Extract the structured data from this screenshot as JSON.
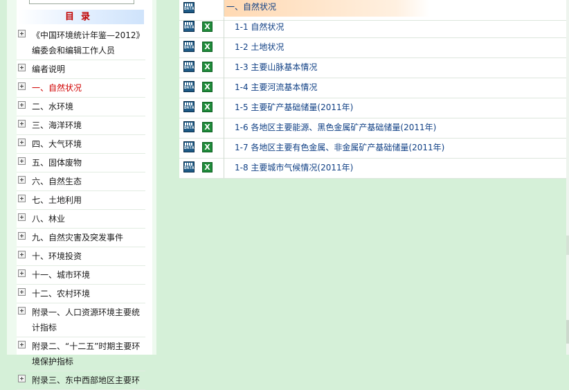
{
  "sidebar": {
    "header": "目录",
    "items": [
      {
        "label": "《中国环境统计年鉴—2012》编委会和编辑工作人员",
        "active": false
      },
      {
        "label": "编者说明",
        "active": false
      },
      {
        "label": "一、自然状况",
        "active": true
      },
      {
        "label": "二、水环境",
        "active": false
      },
      {
        "label": "三、海洋环境",
        "active": false
      },
      {
        "label": "四、大气环境",
        "active": false
      },
      {
        "label": "五、固体废物",
        "active": false
      },
      {
        "label": "六、自然生态",
        "active": false
      },
      {
        "label": "七、土地利用",
        "active": false
      },
      {
        "label": "八、林业",
        "active": false
      },
      {
        "label": "九、自然灾害及突发事件",
        "active": false
      },
      {
        "label": "十、环境投资",
        "active": false
      },
      {
        "label": "十一、城市环境",
        "active": false
      },
      {
        "label": "十二、农村环境",
        "active": false
      },
      {
        "label": "附录一、人口资源环境主要统计指标",
        "active": false
      },
      {
        "label": "附录二、“十二五”时期主要环境保护指标",
        "active": false
      },
      {
        "label": "附录三、东中西部地区主要环",
        "active": false
      }
    ]
  },
  "table": {
    "section_title": "一、自然状况",
    "icon_text": "DATA",
    "excel_glyph": "X",
    "rows": [
      {
        "label": "1-1 自然状况"
      },
      {
        "label": "1-2 土地状况"
      },
      {
        "label": "1-3 主要山脉基本情况"
      },
      {
        "label": "1-4 主要河流基本情况"
      },
      {
        "label": "1-5 主要矿产基础储量(2011年)"
      },
      {
        "label": "1-6 各地区主要能源、黑色金属矿产基础储量(2011年)"
      },
      {
        "label": "1-7 各地区主要有色金属、非金属矿产基础储量(2011年)"
      },
      {
        "label": "1-8 主要城市气候情况(2011年)"
      }
    ]
  },
  "colors": {
    "page_bg": "#d5f0d8",
    "active_item": "#d00000",
    "link": "#0f3f84",
    "header_text": "#c00000"
  }
}
